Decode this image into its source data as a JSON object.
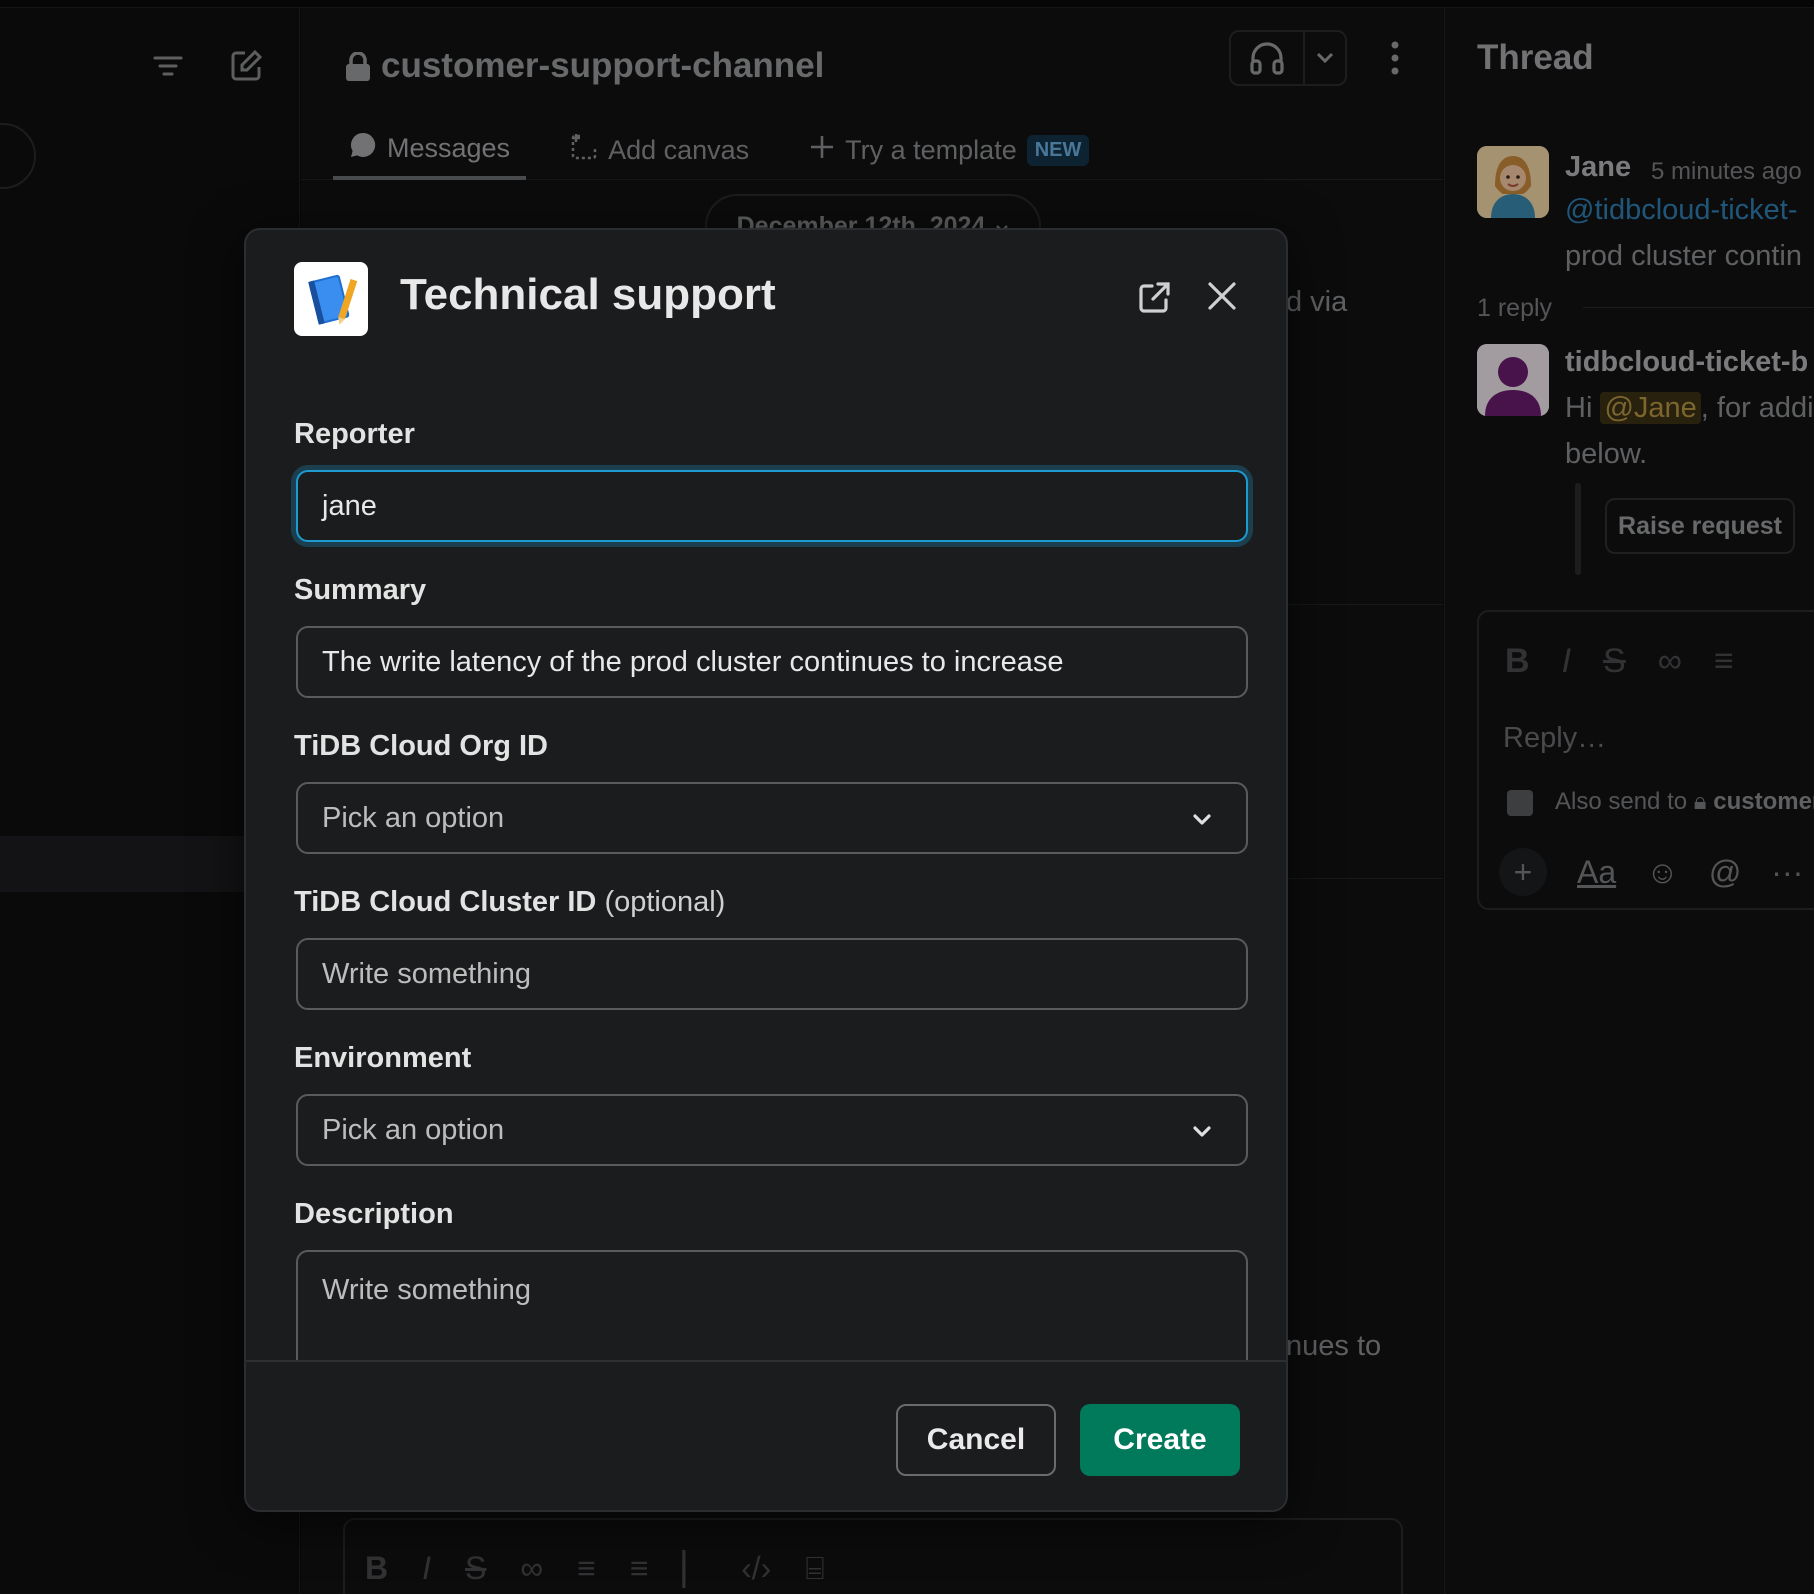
{
  "channel": {
    "name": "customer-support-channel",
    "tabs": [
      {
        "label": "Messages"
      },
      {
        "label": "Add canvas"
      },
      {
        "label": "Try a template",
        "badge": "NEW"
      }
    ],
    "date_pill": "December 12th, 2024",
    "bg_snippets": {
      "via": "d via",
      "continues": "nues to"
    }
  },
  "thread": {
    "title": "Thread",
    "root": {
      "author": "Jane",
      "time": "5 minutes ago",
      "mention": "@tidbcloud-ticket-",
      "text": "prod cluster contin"
    },
    "replies_count": "1 reply",
    "reply": {
      "author": "tidbcloud-ticket-b",
      "prefix": "Hi",
      "mention": "@Jane",
      "suffix": ", for addi",
      "line2": "below.",
      "button": "Raise request"
    },
    "composer": {
      "placeholder": "Reply…",
      "also_send": "Also send to",
      "also_channel": "customer",
      "aa": "Aa"
    }
  },
  "modal": {
    "title": "Technical support",
    "fields": {
      "reporter": {
        "label": "Reporter",
        "value": "jane"
      },
      "summary": {
        "label": "Summary",
        "value": "The write latency of the prod cluster continues to increase"
      },
      "org_id": {
        "label": "TiDB Cloud Org ID",
        "placeholder": "Pick an option"
      },
      "cluster_id": {
        "label": "TiDB Cloud Cluster ID",
        "optional": "(optional)",
        "placeholder": "Write something"
      },
      "environment": {
        "label": "Environment",
        "placeholder": "Pick an option"
      },
      "description": {
        "label": "Description",
        "placeholder": "Write something"
      }
    },
    "buttons": {
      "cancel": "Cancel",
      "create": "Create"
    }
  },
  "colors": {
    "accent_focus": "#1d9bd1",
    "create_button": "#007a5a",
    "link": "#2f7fb3",
    "mention_bg": "#3a3116"
  },
  "icons": [
    "filter-icon",
    "compose-icon",
    "lock-icon",
    "headphones-icon",
    "chevron-down-icon",
    "kebab-icon",
    "messages-icon",
    "canvas-icon",
    "plus-icon",
    "popout-icon",
    "close-icon",
    "app-notebook-icon",
    "bold-icon",
    "italic-icon",
    "strike-icon",
    "link-icon",
    "list-icon",
    "emoji-icon",
    "mention-icon",
    "more-icon"
  ]
}
